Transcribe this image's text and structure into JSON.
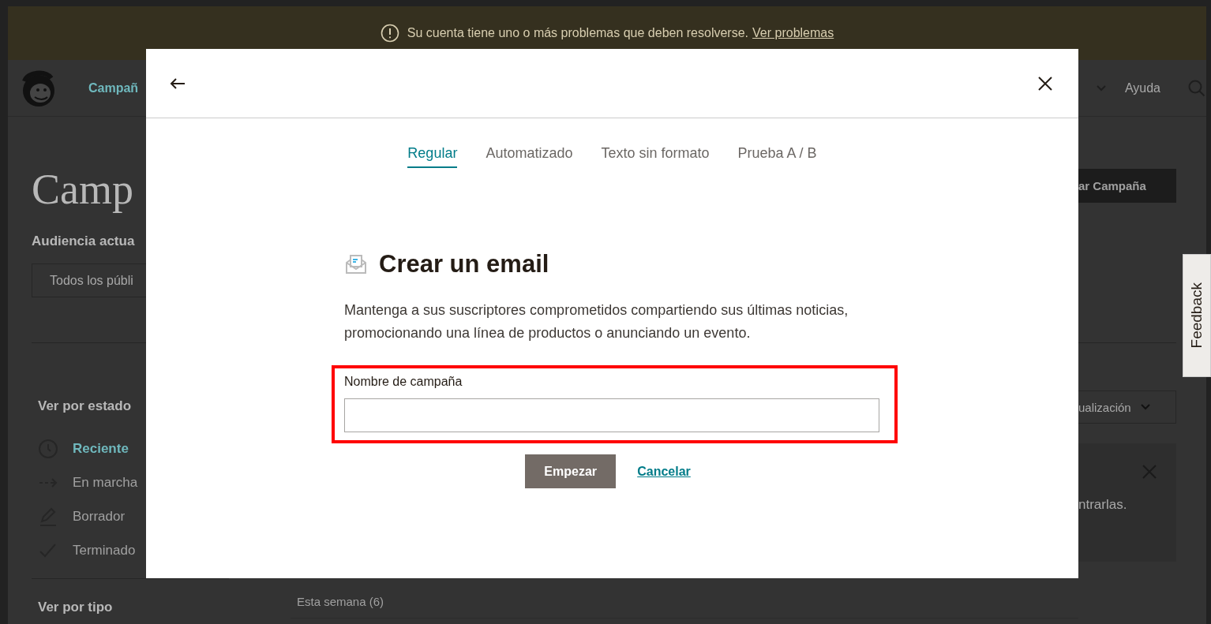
{
  "banner": {
    "message": "Su cuenta tiene uno o más problemas que deben resolverse.",
    "link": "Ver problemas"
  },
  "nav": {
    "items": [
      "Campañ"
    ],
    "help": "Ayuda"
  },
  "page": {
    "title": "Camp",
    "audience_label": "Audiencia actua",
    "audience_select": "Todos los públi",
    "create_button": "ar Campaña",
    "status_heading": "Ver por estado",
    "status_items": [
      {
        "kind": "recent",
        "label": "Reciente",
        "selected": true
      },
      {
        "kind": "ongoing",
        "label": "En marcha",
        "selected": false
      },
      {
        "kind": "draft",
        "label": "Borrador",
        "selected": false
      },
      {
        "kind": "done",
        "label": "Terminado",
        "selected": false
      }
    ],
    "type_heading": "Ver por tipo",
    "sort_select": "ualización",
    "notice_text": "ntrarlas.",
    "group_heading": "Esta semana (6)"
  },
  "modal": {
    "tabs": [
      {
        "label": "Regular",
        "selected": true
      },
      {
        "label": "Automatizado",
        "selected": false
      },
      {
        "label": "Texto sin formato",
        "selected": false
      },
      {
        "label": "Prueba A / B",
        "selected": false
      }
    ],
    "title": "Crear un email",
    "description": "Mantenga a sus suscriptores comprometidos compartiendo sus últimas noticias, promocionando una línea de productos o anunciando un evento.",
    "field_label": "Nombre de campaña",
    "primary_button": "Empezar",
    "cancel_link": "Cancelar"
  },
  "feedback": "Feedback"
}
